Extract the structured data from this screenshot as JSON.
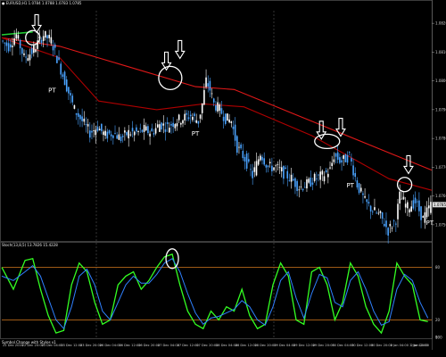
{
  "window": {
    "symbol_header": "● EURUSD,H1  1.0784 1.0788 1.0783 1.0785",
    "indicator_header": "Stoch(13,8,5) 13.7826 15.4228",
    "bottom_label": "Symbol Change with Styles v1",
    "price_scale_marker": "1.0785"
  },
  "colors": {
    "background": "#000000",
    "candle": "#ffffff",
    "candle_bear_tint": "#4aa3ff",
    "ma_fast": "#e01818",
    "ma_slow": "#b00000",
    "ma_lead": "#22cc33",
    "stoch_main": "#33ff22",
    "stoch_signal": "#2f80ff",
    "level_lines": "#d2781e",
    "grid": "#555555",
    "annotation": "#ffffff"
  },
  "chart_data": [
    {
      "type": "candlestick",
      "panel": "price",
      "y_ticks": [
        "1.0820",
        "1.0810",
        "1.0800",
        "1.0790",
        "1.0780",
        "1.0770",
        "1.0760",
        "1.0750"
      ],
      "ylim": [
        1.0745,
        1.0825
      ],
      "x_ticks": [
        "22 Dec 2016",
        "22 Dec 20:00",
        "23 Dec 04:00",
        "23 Dec 12:00",
        "23 Dec 20:00",
        "26 Dec 04:00",
        "26 Dec 12:00",
        "26 Dec 20:00",
        "27 Dec 04:00",
        "27 Dec 12:00",
        "27 Dec 20:00",
        "28 Dec 04:00",
        "28 Dec 12:00",
        "28 Dec 20:00",
        "29 Dec 04:00",
        "29 Dec 12:00",
        "29 Dec 20:00",
        "30 Dec 04:00",
        "30 Dec 12:00",
        "30 Dec 20:00",
        "2 Jan 04:00",
        "2 Jan 12:00",
        "2 Jan 20:00"
      ],
      "close_path": [
        [
          0,
          1.0814
        ],
        [
          4,
          1.0812
        ],
        [
          8,
          1.0816
        ],
        [
          12,
          1.0808
        ],
        [
          16,
          1.081
        ],
        [
          18,
          1.0812
        ],
        [
          22,
          1.0816
        ],
        [
          26,
          1.0814
        ],
        [
          30,
          1.0806
        ],
        [
          34,
          1.0798
        ],
        [
          38,
          1.079
        ],
        [
          42,
          1.0786
        ],
        [
          46,
          1.0782
        ],
        [
          50,
          1.0784
        ],
        [
          54,
          1.0781
        ],
        [
          58,
          1.0782
        ],
        [
          62,
          1.078
        ],
        [
          66,
          1.0782
        ],
        [
          70,
          1.0782
        ],
        [
          74,
          1.0783
        ],
        [
          78,
          1.0782
        ],
        [
          82,
          1.0785
        ],
        [
          86,
          1.0784
        ],
        [
          90,
          1.0786
        ],
        [
          94,
          1.0787
        ],
        [
          98,
          1.0788
        ],
        [
          102,
          1.0786
        ],
        [
          104,
          1.0792
        ],
        [
          106,
          1.08
        ],
        [
          108,
          1.0797
        ],
        [
          110,
          1.0792
        ],
        [
          113,
          1.079
        ],
        [
          116,
          1.0787
        ],
        [
          119,
          1.0786
        ],
        [
          122,
          1.0777
        ],
        [
          126,
          1.0773
        ],
        [
          130,
          1.0767
        ],
        [
          134,
          1.0775
        ],
        [
          138,
          1.077
        ],
        [
          142,
          1.077
        ],
        [
          146,
          1.0768
        ],
        [
          150,
          1.0766
        ],
        [
          154,
          1.0763
        ],
        [
          158,
          1.0764
        ],
        [
          162,
          1.0766
        ],
        [
          166,
          1.0767
        ],
        [
          170,
          1.0769
        ],
        [
          172,
          1.0774
        ],
        [
          176,
          1.0772
        ],
        [
          180,
          1.0774
        ],
        [
          184,
          1.0764
        ],
        [
          188,
          1.0758
        ],
        [
          192,
          1.0755
        ],
        [
          196,
          1.0753
        ],
        [
          200,
          1.0748
        ],
        [
          204,
          1.0752
        ],
        [
          206,
          1.076
        ],
        [
          210,
          1.0756
        ],
        [
          214,
          1.0758
        ],
        [
          218,
          1.0752
        ],
        [
          222,
          1.0757
        ]
      ],
      "series": [
        {
          "name": "",
          "values": [
            [
              0,
              1.0815
            ],
            [
              30,
              1.0812
            ],
            [
              60,
              1.0806
            ],
            [
              100,
              1.0798
            ],
            [
              120,
              1.0797
            ],
            [
              160,
              1.0786
            ],
            [
              200,
              1.0775
            ],
            [
              222,
              1.0769
            ]
          ]
        },
        {
          "name": "",
          "values": [
            [
              0,
              1.0815
            ],
            [
              30,
              1.0808
            ],
            [
              50,
              1.0793
            ],
            [
              80,
              1.079
            ],
            [
              104,
              1.0792
            ],
            [
              125,
              1.0791
            ],
            [
              160,
              1.0781
            ],
            [
              200,
              1.0766
            ],
            [
              222,
              1.0762
            ]
          ]
        },
        {
          "name": "",
          "values": [
            [
              0,
              1.0816
            ],
            [
              16,
              1.0817
            ]
          ]
        }
      ],
      "annotations": [
        {
          "kind": "circle",
          "label": "",
          "at": [
            16,
            1.0815
          ]
        },
        {
          "kind": "arrow",
          "label": "",
          "at": [
            18,
            1.0823
          ]
        },
        {
          "kind": "text",
          "label": "PT",
          "at": [
            24,
            1.0796
          ]
        },
        {
          "kind": "circle",
          "label": "",
          "at": [
            87,
            1.0801
          ]
        },
        {
          "kind": "arrow",
          "label": "",
          "at": [
            85,
            1.081
          ]
        },
        {
          "kind": "arrow",
          "label": "",
          "at": [
            92,
            1.0814
          ]
        },
        {
          "kind": "text",
          "label": "PT",
          "at": [
            98,
            1.0781
          ]
        },
        {
          "kind": "text",
          "label": "PT",
          "at": [
            178,
            1.0763
          ]
        },
        {
          "kind": "circle",
          "label": "",
          "at": [
            168,
            1.0779
          ]
        },
        {
          "kind": "arrow",
          "label": "",
          "at": [
            165,
            1.0786
          ]
        },
        {
          "kind": "arrow",
          "label": "",
          "at": [
            175,
            1.0787
          ]
        },
        {
          "kind": "circle",
          "label": "",
          "at": [
            208,
            1.0764
          ]
        },
        {
          "kind": "arrow",
          "label": "",
          "at": [
            210,
            1.0774
          ]
        },
        {
          "kind": "text",
          "label": "PT",
          "at": [
            219,
            1.075
          ]
        }
      ]
    },
    {
      "type": "line",
      "panel": "stochastic",
      "title": "Stoch(13,8,5) 13.7826 15.4228",
      "ylim": [
        0,
        100
      ],
      "levels": [
        80,
        20
      ],
      "series": [
        {
          "name": "",
          "values": [
            [
              0,
              80
            ],
            [
              6,
              55
            ],
            [
              12,
              88
            ],
            [
              16,
              90
            ],
            [
              20,
              55
            ],
            [
              24,
              25
            ],
            [
              28,
              5
            ],
            [
              32,
              8
            ],
            [
              36,
              60
            ],
            [
              40,
              85
            ],
            [
              44,
              75
            ],
            [
              48,
              40
            ],
            [
              52,
              15
            ],
            [
              56,
              20
            ],
            [
              60,
              60
            ],
            [
              64,
              70
            ],
            [
              68,
              75
            ],
            [
              72,
              55
            ],
            [
              76,
              65
            ],
            [
              80,
              80
            ],
            [
              84,
              92
            ],
            [
              88,
              95
            ],
            [
              92,
              60
            ],
            [
              96,
              30
            ],
            [
              100,
              15
            ],
            [
              104,
              10
            ],
            [
              108,
              30
            ],
            [
              112,
              20
            ],
            [
              116,
              35
            ],
            [
              120,
              30
            ],
            [
              124,
              55
            ],
            [
              128,
              25
            ],
            [
              132,
              10
            ],
            [
              136,
              15
            ],
            [
              140,
              60
            ],
            [
              144,
              85
            ],
            [
              148,
              70
            ],
            [
              152,
              20
            ],
            [
              156,
              15
            ],
            [
              160,
              75
            ],
            [
              164,
              80
            ],
            [
              168,
              60
            ],
            [
              172,
              20
            ],
            [
              176,
              40
            ],
            [
              180,
              85
            ],
            [
              184,
              70
            ],
            [
              188,
              35
            ],
            [
              192,
              15
            ],
            [
              196,
              5
            ],
            [
              200,
              30
            ],
            [
              204,
              85
            ],
            [
              208,
              70
            ],
            [
              212,
              60
            ],
            [
              216,
              20
            ],
            [
              220,
              18
            ]
          ]
        },
        {
          "name": "",
          "values": [
            [
              0,
              70
            ],
            [
              6,
              65
            ],
            [
              12,
              75
            ],
            [
              16,
              82
            ],
            [
              20,
              70
            ],
            [
              24,
              45
            ],
            [
              28,
              20
            ],
            [
              32,
              10
            ],
            [
              36,
              35
            ],
            [
              40,
              70
            ],
            [
              44,
              78
            ],
            [
              48,
              60
            ],
            [
              52,
              30
            ],
            [
              56,
              20
            ],
            [
              60,
              40
            ],
            [
              64,
              60
            ],
            [
              68,
              70
            ],
            [
              72,
              62
            ],
            [
              76,
              62
            ],
            [
              80,
              72
            ],
            [
              84,
              85
            ],
            [
              88,
              90
            ],
            [
              92,
              75
            ],
            [
              96,
              50
            ],
            [
              100,
              28
            ],
            [
              104,
              15
            ],
            [
              108,
              22
            ],
            [
              112,
              24
            ],
            [
              116,
              28
            ],
            [
              120,
              32
            ],
            [
              124,
              42
            ],
            [
              128,
              35
            ],
            [
              132,
              20
            ],
            [
              136,
              14
            ],
            [
              140,
              35
            ],
            [
              144,
              65
            ],
            [
              148,
              75
            ],
            [
              152,
              45
            ],
            [
              156,
              22
            ],
            [
              160,
              50
            ],
            [
              164,
              72
            ],
            [
              168,
              68
            ],
            [
              172,
              40
            ],
            [
              176,
              35
            ],
            [
              180,
              65
            ],
            [
              184,
              75
            ],
            [
              188,
              55
            ],
            [
              192,
              30
            ],
            [
              196,
              14
            ],
            [
              200,
              18
            ],
            [
              204,
              55
            ],
            [
              208,
              72
            ],
            [
              212,
              65
            ],
            [
              216,
              40
            ],
            [
              220,
              22
            ]
          ]
        }
      ],
      "annotations": [
        {
          "kind": "circle",
          "label": "",
          "at": [
            88,
            90
          ]
        }
      ]
    }
  ]
}
